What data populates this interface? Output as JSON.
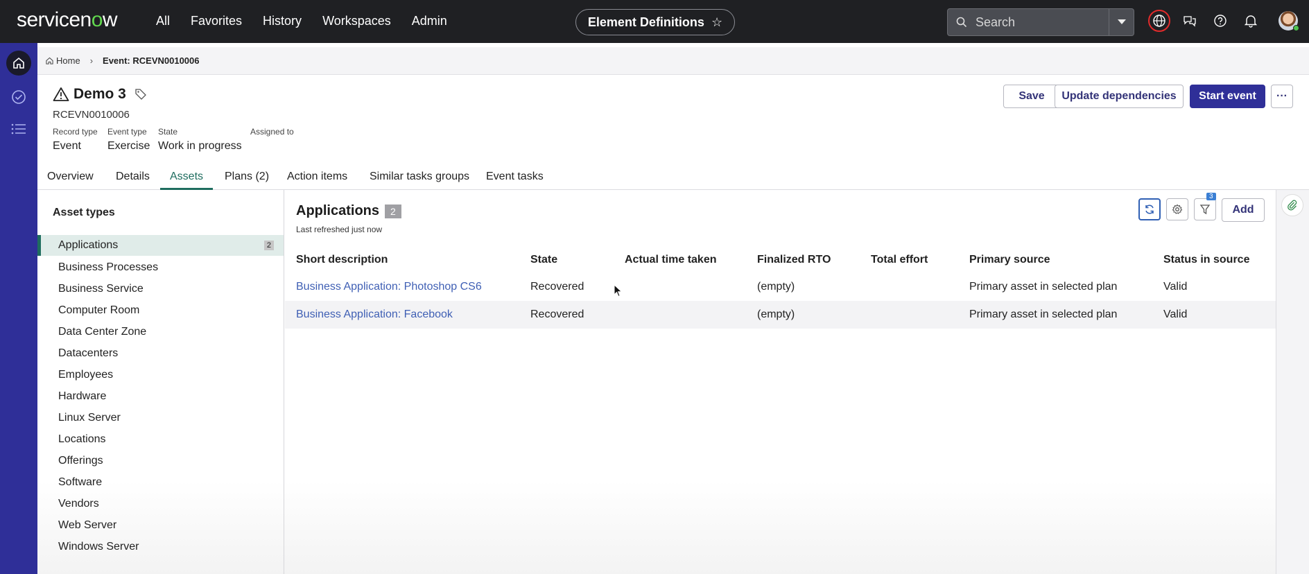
{
  "topnav": {
    "logo": "servicenow",
    "links": [
      "All",
      "Favorites",
      "History",
      "Workspaces",
      "Admin"
    ],
    "pill_label": "Element Definitions",
    "search_placeholder": "Search"
  },
  "breadcrumb": {
    "home": "Home",
    "current": "Event: RCEVN0010006"
  },
  "record": {
    "title": "Demo 3",
    "number": "RCEVN0010006",
    "fields": [
      {
        "label": "Record type",
        "value": "Event"
      },
      {
        "label": "Event type",
        "value": "Exercise"
      },
      {
        "label": "State",
        "value": "Work in progress"
      },
      {
        "label": "Assigned to",
        "value": ""
      }
    ],
    "buttons": {
      "save": "Save",
      "update": "Update dependencies",
      "start": "Start event",
      "more": "···"
    }
  },
  "tabs": [
    "Overview",
    "Details",
    "Assets",
    "Plans (2)",
    "Action items",
    "Similar tasks groups",
    "Event tasks"
  ],
  "active_tab": "Assets",
  "asset_types": {
    "title": "Asset types",
    "items": [
      {
        "label": "Applications",
        "count": "2"
      },
      {
        "label": "Business Processes"
      },
      {
        "label": "Business Service"
      },
      {
        "label": "Computer Room"
      },
      {
        "label": "Data Center Zone"
      },
      {
        "label": "Datacenters"
      },
      {
        "label": "Employees"
      },
      {
        "label": "Hardware"
      },
      {
        "label": "Linux Server"
      },
      {
        "label": "Locations"
      },
      {
        "label": "Offerings"
      },
      {
        "label": "Software"
      },
      {
        "label": "Vendors"
      },
      {
        "label": "Web Server"
      },
      {
        "label": "Windows Server"
      }
    ]
  },
  "list": {
    "title": "Applications",
    "count": "2",
    "refreshed": "Last refreshed just now",
    "filter_count": "3",
    "add_label": "Add",
    "columns": [
      "Short description",
      "State",
      "Actual time taken",
      "Finalized RTO",
      "Total effort",
      "Primary source",
      "Status in source"
    ],
    "rows": [
      [
        "Business Application: Photoshop CS6",
        "Recovered",
        "",
        "(empty)",
        "",
        "Primary asset in selected plan",
        "Valid"
      ],
      [
        "Business Application: Facebook",
        "Recovered",
        "",
        "(empty)",
        "",
        "Primary asset in selected plan",
        "Valid"
      ]
    ]
  },
  "colors": {
    "nav_bg": "#1f2023",
    "rail_bg": "#2f2f98",
    "accent_green": "#1f6d5f",
    "primary_button": "#2f2f98",
    "link": "#3f5fb4"
  }
}
